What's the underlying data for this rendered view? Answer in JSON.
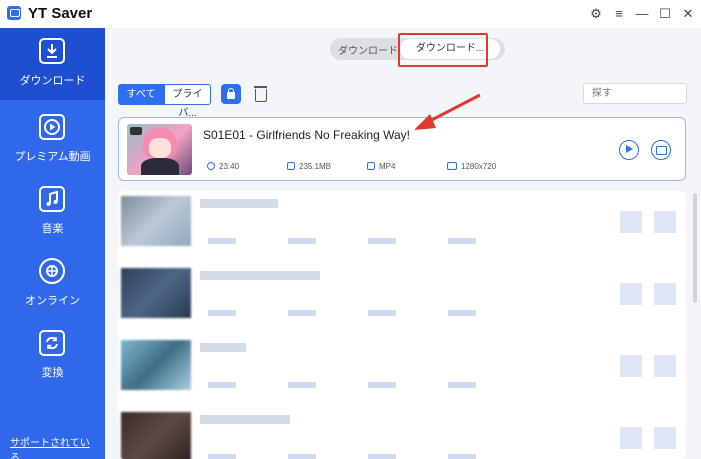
{
  "app": {
    "title": "YT Saver",
    "accent_color": "#3068ea",
    "annotation_color": "#e03a2f",
    "window_controls": [
      "gear-icon",
      "menu-icon",
      "minimize-icon",
      "maximize-icon",
      "close-icon"
    ]
  },
  "sidebar": {
    "items": [
      {
        "label": "ダウンロード",
        "icon": "download-icon",
        "active": true
      },
      {
        "label": "プレミアム動画",
        "icon": "premium-video-icon",
        "active": false
      },
      {
        "label": "音楽",
        "icon": "music-icon",
        "active": false
      },
      {
        "label": "オンライン",
        "icon": "online-icon",
        "active": false
      },
      {
        "label": "変換",
        "icon": "convert-icon",
        "active": false
      }
    ],
    "support_link": "サポートされている..."
  },
  "top_tabs": {
    "downloading": "ダウンロード中",
    "downloaded": "ダウンロード..."
  },
  "filters": {
    "all": "すべて",
    "private": "プライバ..."
  },
  "search": {
    "placeholder": "探す"
  },
  "active_item": {
    "title": "S01E01 - Girlfriends No Freaking Way!",
    "duration": "23:40",
    "size": "235.1MB",
    "format": "MP4",
    "resolution": "1280x720"
  }
}
